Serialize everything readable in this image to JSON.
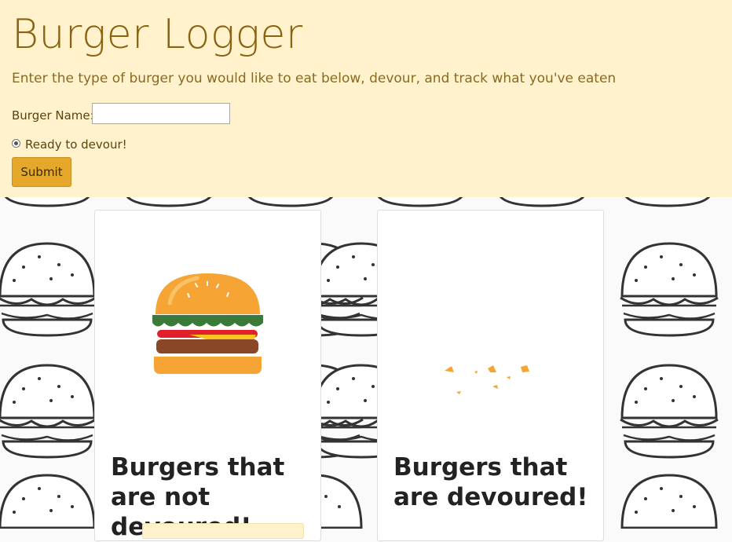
{
  "header": {
    "title": "Burger Logger",
    "subtitle": "Enter the type of burger you would like to eat below, devour, and track what you've eaten"
  },
  "form": {
    "name_label": "Burger Name:",
    "name_value": "",
    "radio_label": "Ready to devour!",
    "radio_checked": true,
    "submit_label": "Submit"
  },
  "cards": [
    {
      "title": "Burgers that are not devoured!",
      "icon": "burger-icon"
    },
    {
      "title": "Burgers that are devoured!",
      "icon": "crumbs-icon"
    }
  ],
  "colors": {
    "header_bg": "#fff2cc",
    "title": "#8a6311",
    "submit_bg": "#e5a82a"
  }
}
